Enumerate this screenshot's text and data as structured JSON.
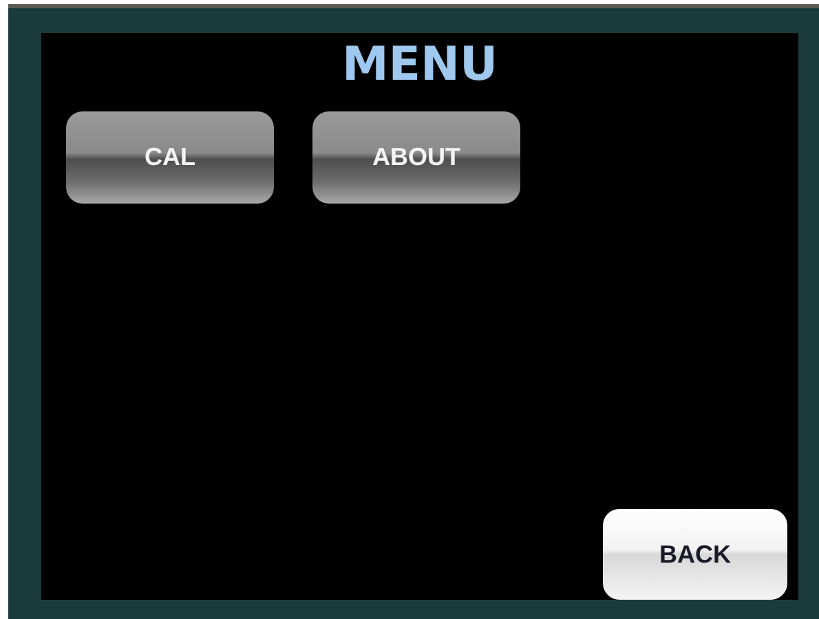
{
  "title": "MENU",
  "buttons": [
    {
      "label": "CAL",
      "kind": "dark"
    },
    {
      "label": "ABOUT",
      "kind": "dark"
    }
  ],
  "back_button": {
    "label": "BACK",
    "kind": "light"
  }
}
